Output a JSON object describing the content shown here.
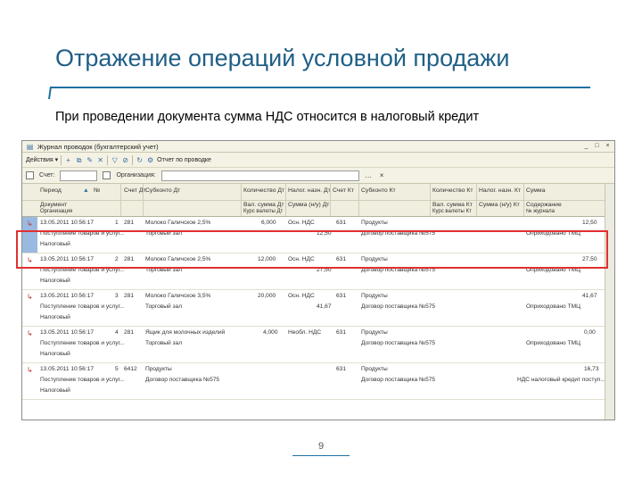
{
  "slide": {
    "title": "Отражение операций условной продажи",
    "subtitle": "При проведении документа сумма НДС относится в налоговый кредит",
    "page_number": "9"
  },
  "window": {
    "title": "Журнал проводок (бухгалтерский учет)",
    "controls": [
      "_",
      "□",
      "×"
    ]
  },
  "toolbar": {
    "actions_label": "Действия ▾",
    "report_label": "Отчет по проводке"
  },
  "filters": {
    "account_label": "Счет:",
    "org_label": "Организация:"
  },
  "columns": {
    "row1": [
      "Период",
      "№",
      "Счет Дт",
      "Субконто Дт",
      "Количество Дт",
      "Налог. назн. Дт",
      "Счет Кт",
      "Субконто Кт",
      "Количество Кт",
      "Налог. назн. Кт",
      "Сумма"
    ],
    "row2": [
      "Документ",
      "Вал. сумма Дт",
      "Сумма (н/у) Дт",
      "Вал. сумма Кт",
      "Сумма (н/у) Кт",
      "Содержание"
    ],
    "row3": [
      "Организация",
      "Курс валюты Дт",
      "Курс валюты Кт",
      "№ журнала"
    ]
  },
  "rows": [
    {
      "period": "13.05.2011 10:56:17",
      "doc": "Поступление товаров и услуг...",
      "org": "Налоговый",
      "n": "1",
      "acc_dt": "281",
      "sub_dt1": "Молоко Галичское 2,5%",
      "sub_dt2": "Торговый зал",
      "qty_dt": "6,000",
      "tax_dt": "Осн. НДС",
      "acc_kt": "631",
      "sub_kt1": "Продукты",
      "sub_kt2": "Договор поставщика №575",
      "sum_nu": "12,50",
      "content": "Оприходовано ТМЦ",
      "amount": "12,50"
    },
    {
      "period": "13.05.2011 10:56:17",
      "doc": "Поступление товаров и услуг...",
      "org": "Налоговый",
      "n": "2",
      "acc_dt": "281",
      "sub_dt1": "Молоко Галичское 2,5%",
      "sub_dt2": "Торговый зал",
      "qty_dt": "12,000",
      "tax_dt": "Осн. НДС",
      "acc_kt": "631",
      "sub_kt1": "Продукты",
      "sub_kt2": "Договор поставщика №575",
      "sum_nu": "27,50",
      "content": "Оприходовано ТМЦ",
      "amount": "27,50"
    },
    {
      "period": "13.05.2011 10:56:17",
      "doc": "Поступление товаров и услуг...",
      "org": "Налоговый",
      "n": "3",
      "acc_dt": "281",
      "sub_dt1": "Молоко Галичское 3,5%",
      "sub_dt2": "Торговый зал",
      "qty_dt": "20,000",
      "tax_dt": "Осн. НДС",
      "acc_kt": "631",
      "sub_kt1": "Продукты",
      "sub_kt2": "Договор поставщика №575",
      "sum_nu": "41,67",
      "content": "Оприходовано ТМЦ",
      "amount": "41,67"
    },
    {
      "period": "13.05.2011 10:56:17",
      "doc": "Поступление товаров и услуг...",
      "org": "Налоговый",
      "n": "4",
      "acc_dt": "281",
      "sub_dt1": "Ящик для молочных изделий",
      "sub_dt2": "Торговый зал",
      "qty_dt": "4,000",
      "tax_dt": "Необл. НДС",
      "acc_kt": "631",
      "sub_kt1": "Продукты",
      "sub_kt2": "Договор поставщика №575",
      "sum_nu": "",
      "content": "Оприходовано ТМЦ",
      "amount": "0,00"
    },
    {
      "period": "13.05.2011 10:56:17",
      "doc": "Поступление товаров и услуг...",
      "org": "Налоговый",
      "n": "5",
      "acc_dt": "6412",
      "sub_dt1": "Продукты",
      "sub_dt2": "Договор поставщика №575",
      "qty_dt": "",
      "tax_dt": "",
      "acc_kt": "631",
      "sub_kt1": "Продукты",
      "sub_kt2": "Договор поставщика №575",
      "sum_nu": "",
      "content": "НДС налоговый кредит поступ...",
      "amount": "16,73"
    }
  ]
}
